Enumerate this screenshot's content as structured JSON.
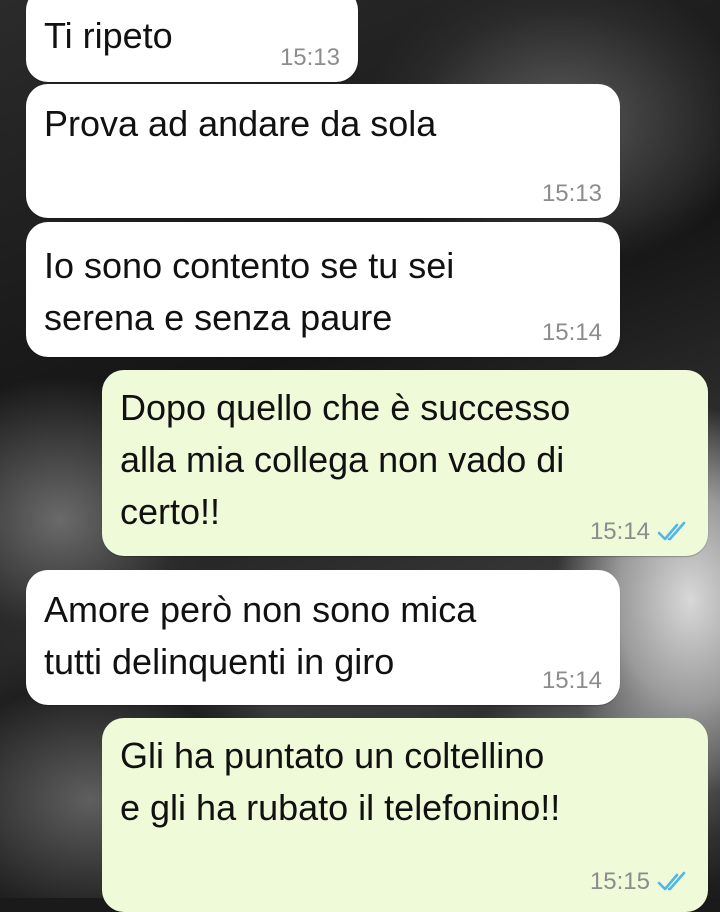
{
  "chat": {
    "messages": [
      {
        "direction": "in",
        "text": "Ti ripeto",
        "time": "15:13"
      },
      {
        "direction": "in",
        "text": "Prova ad andare da sola",
        "time": "15:13"
      },
      {
        "direction": "in",
        "text": "Io sono contento se tu sei\nserena e senza paure",
        "time": "15:14"
      },
      {
        "direction": "out",
        "text": "Dopo quello che è successo\nalla mia collega non vado di\ncerto!!",
        "time": "15:14",
        "status_icon": "read-double-check-icon"
      },
      {
        "direction": "in",
        "text": "Amore però non sono mica\ntutti delinquenti in giro",
        "time": "15:14"
      },
      {
        "direction": "out",
        "text": "Gli ha puntato un coltellino\ne gli ha rubato il telefonino!!",
        "time": "15:15",
        "status_icon": "read-double-check-icon"
      }
    ]
  },
  "colors": {
    "incoming_bubble": "#ffffff",
    "outgoing_bubble": "#effad8",
    "read_tick": "#4fb6ec",
    "timestamp": "#8c8c8c"
  }
}
